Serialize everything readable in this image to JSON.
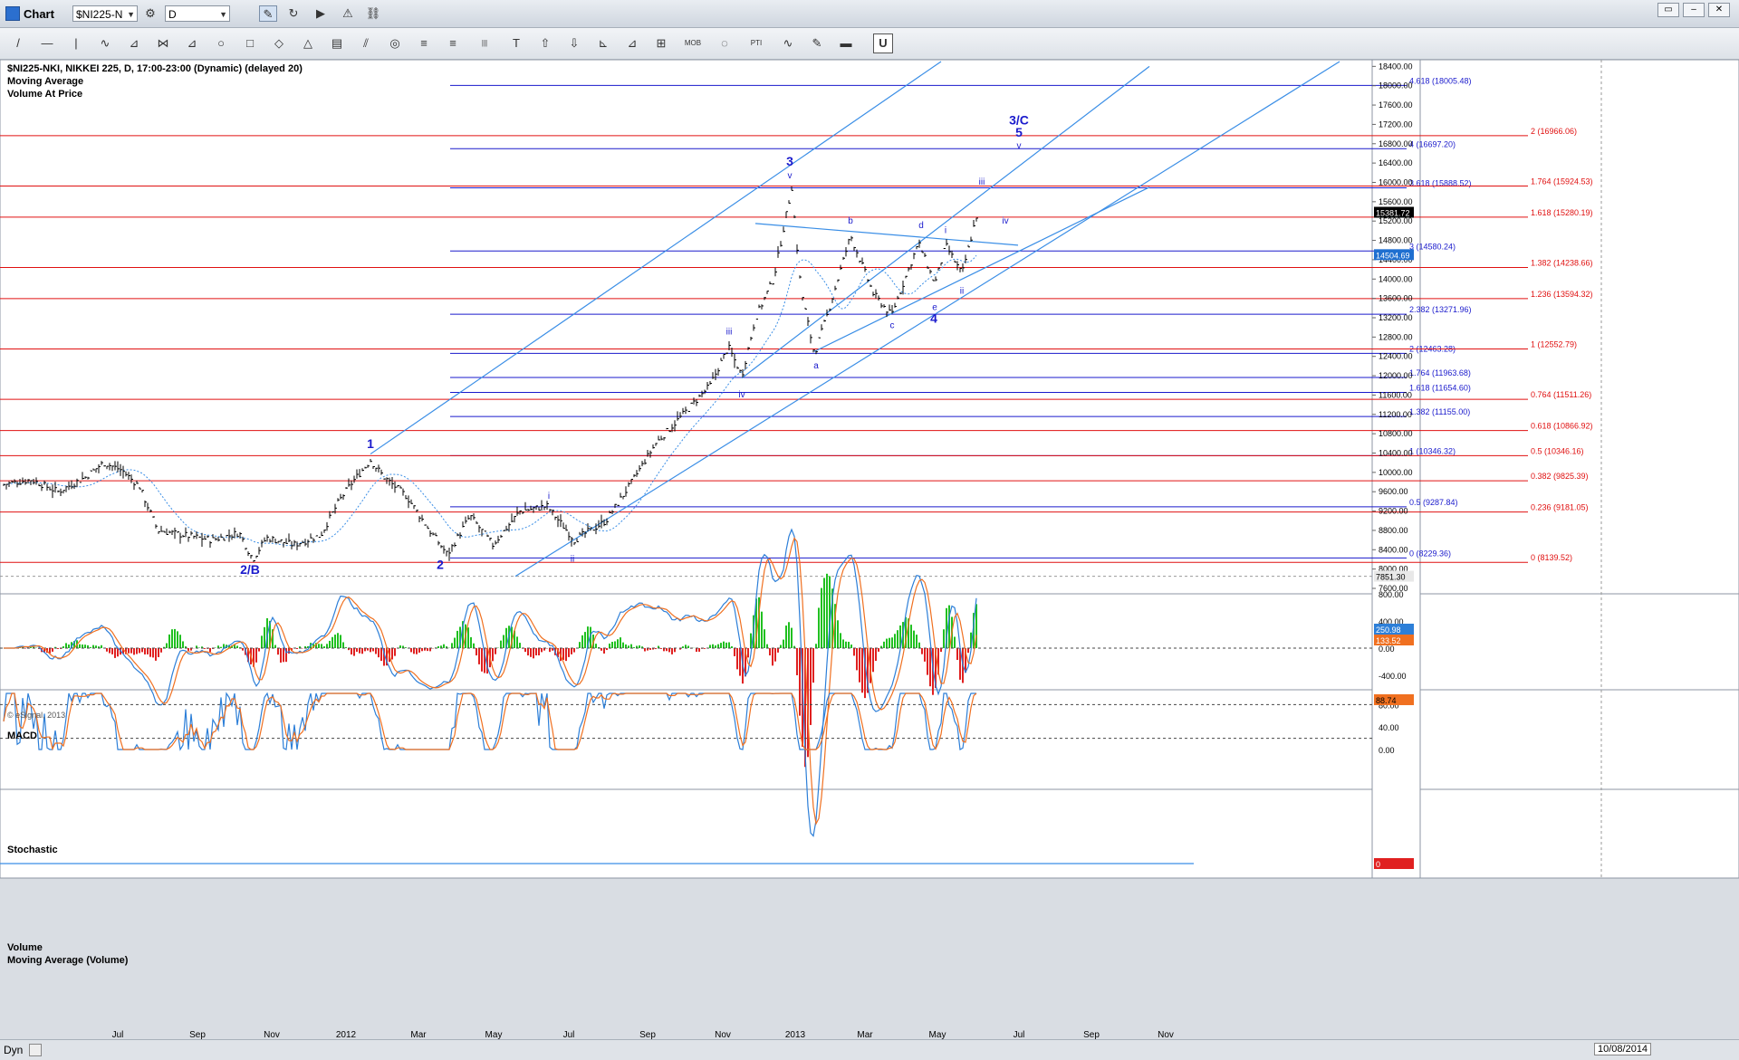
{
  "window": {
    "title": "Chart"
  },
  "toolbar": {
    "symbol": "$NI225-N",
    "interval": "D",
    "tools": [
      "/",
      "—",
      "|",
      "∿",
      "⊿",
      "⋈",
      "⊿",
      "○",
      "□",
      "◇",
      "△",
      "▤",
      "⫽",
      "◎",
      "≡",
      "≡",
      "|||",
      "T",
      "⇧",
      "⇩",
      "⊾",
      "⊿",
      "⊞",
      "MOB",
      "◌",
      "PTI",
      "∿",
      "✎",
      "▬"
    ],
    "lock_icon": "U"
  },
  "header": {
    "line1": "$NI225-NKI, NIKKEI 225, D, 17:00-23:00 (Dynamic) (delayed 20)",
    "line2": "Moving Average",
    "line3": "Volume At Price"
  },
  "copyright": "© eSignal, 2013",
  "panes": {
    "macd": {
      "label": "MACD",
      "macd_value": "250.98",
      "signal_value": "133.52",
      "ticks": [
        "800.00",
        "400.00",
        "0.00",
        "-400.00"
      ]
    },
    "stochastic": {
      "label": "Stochastic",
      "value": "88.74",
      "ticks": [
        "80.00",
        "40.00",
        "0.00"
      ]
    },
    "volume": {
      "label1": "Volume",
      "label2": "Moving Average (Volume)",
      "value": "0"
    }
  },
  "bottom": {
    "label": "Dyn",
    "date_badge": "10/08/2014"
  },
  "colors": {
    "price_bar": "#000000",
    "fib_blue": "#1a1acc",
    "fib_red": "#e01010",
    "channel": "#3a8ee6",
    "ma": "#3a8ee6",
    "wave_label": "#1a1acc",
    "macd_line": "#2d7fd8",
    "signal_line": "#f07020",
    "hist_pos": "#20c020",
    "hist_neg": "#e02020"
  },
  "chart_data": {
    "type": "line",
    "title": "$NI225-NKI, NIKKEI 225, D",
    "x_ticks": [
      "Jul",
      "Sep",
      "Nov",
      "2012",
      "Mar",
      "May",
      "Jul",
      "Sep",
      "Nov",
      "2013",
      "Mar",
      "May",
      "Jul",
      "Sep",
      "Nov"
    ],
    "y_ticks": [
      18400,
      18000,
      17600,
      17200,
      16800,
      16400,
      16000,
      15600,
      15200,
      14800,
      14400,
      14000,
      13600,
      13200,
      12800,
      12400,
      12000,
      11600,
      11200,
      10800,
      10400,
      10000,
      9600,
      9200,
      8800,
      8400,
      8000,
      7600
    ],
    "ylim": [
      7600,
      18500
    ],
    "last_price": "15381.72",
    "ma_value": "14504.69",
    "crosshair_value": "7851.30",
    "price_anchors": [
      {
        "t": 0,
        "v": 9750
      },
      {
        "t": 30,
        "v": 9850
      },
      {
        "t": 60,
        "v": 9600
      },
      {
        "t": 90,
        "v": 9900
      },
      {
        "t": 110,
        "v": 10200
      },
      {
        "t": 130,
        "v": 10050
      },
      {
        "t": 150,
        "v": 9700
      },
      {
        "t": 170,
        "v": 8800
      },
      {
        "t": 200,
        "v": 8700
      },
      {
        "t": 230,
        "v": 8600
      },
      {
        "t": 260,
        "v": 8750
      },
      {
        "t": 275,
        "v": 8200
      },
      {
        "t": 290,
        "v": 8650
      },
      {
        "t": 320,
        "v": 8500
      },
      {
        "t": 350,
        "v": 8700
      },
      {
        "t": 370,
        "v": 9400
      },
      {
        "t": 385,
        "v": 9800
      },
      {
        "t": 405,
        "v": 10250
      },
      {
        "t": 420,
        "v": 9900
      },
      {
        "t": 445,
        "v": 9500
      },
      {
        "t": 470,
        "v": 8800
      },
      {
        "t": 490,
        "v": 8300
      },
      {
        "t": 515,
        "v": 9100
      },
      {
        "t": 540,
        "v": 8500
      },
      {
        "t": 570,
        "v": 9200
      },
      {
        "t": 600,
        "v": 9300
      },
      {
        "t": 630,
        "v": 8600
      },
      {
        "t": 665,
        "v": 9000
      },
      {
        "t": 690,
        "v": 9700
      },
      {
        "t": 720,
        "v": 10600
      },
      {
        "t": 750,
        "v": 11200
      },
      {
        "t": 780,
        "v": 11800
      },
      {
        "t": 800,
        "v": 12600
      },
      {
        "t": 815,
        "v": 12000
      },
      {
        "t": 830,
        "v": 13200
      },
      {
        "t": 850,
        "v": 14000
      },
      {
        "t": 870,
        "v": 15900
      },
      {
        "t": 880,
        "v": 13800
      },
      {
        "t": 895,
        "v": 12450
      },
      {
        "t": 910,
        "v": 13300
      },
      {
        "t": 935,
        "v": 14900
      },
      {
        "t": 960,
        "v": 13700
      },
      {
        "t": 980,
        "v": 13250
      },
      {
        "t": 1010,
        "v": 14750
      },
      {
        "t": 1028,
        "v": 13900
      },
      {
        "t": 1040,
        "v": 14700
      },
      {
        "t": 1058,
        "v": 14100
      },
      {
        "t": 1075,
        "v": 15380
      }
    ],
    "fib_levels_blue": [
      {
        "ratio": "4.618",
        "value": 18005.48
      },
      {
        "ratio": "4",
        "value": 16697.2
      },
      {
        "ratio": "3.618",
        "value": 15888.52
      },
      {
        "ratio": "3",
        "value": 14580.24
      },
      {
        "ratio": "2.382",
        "value": 13271.96
      },
      {
        "ratio": "2",
        "value": 12463.28
      },
      {
        "ratio": "1.764",
        "value": 11963.68
      },
      {
        "ratio": "1.618",
        "value": 11654.6
      },
      {
        "ratio": "1.382",
        "value": 11155.0
      },
      {
        "ratio": "1",
        "value": 10346.32
      },
      {
        "ratio": "0.5",
        "value": 9287.84
      },
      {
        "ratio": "0",
        "value": 8229.36
      }
    ],
    "fib_levels_red": [
      {
        "ratio": "2",
        "value": 16966.06
      },
      {
        "ratio": "1.764",
        "value": 15924.53
      },
      {
        "ratio": "1.618",
        "value": 15280.19
      },
      {
        "ratio": "1.382",
        "value": 14238.66
      },
      {
        "ratio": "1.236",
        "value": 13594.32
      },
      {
        "ratio": "1",
        "value": 12552.79
      },
      {
        "ratio": "0.764",
        "value": 11511.26
      },
      {
        "ratio": "0.618",
        "value": 10866.92
      },
      {
        "ratio": "0.5",
        "value": 10346.16
      },
      {
        "ratio": "0.382",
        "value": 9825.39
      },
      {
        "ratio": "0.236",
        "value": 9181.05
      },
      {
        "ratio": "0",
        "value": 8139.52
      }
    ],
    "wave_labels": [
      {
        "text": "1",
        "t": 405,
        "v": 10500,
        "size": "big"
      },
      {
        "text": "2/B",
        "t": 272,
        "v": 7900,
        "size": "big"
      },
      {
        "text": "2",
        "t": 482,
        "v": 8000,
        "size": "big"
      },
      {
        "text": "3",
        "t": 868,
        "v": 16350,
        "size": "big"
      },
      {
        "text": "3/C",
        "t": 1121,
        "v": 17200,
        "size": "big"
      },
      {
        "text": "5",
        "t": 1121,
        "v": 16950,
        "size": "big"
      },
      {
        "text": "4",
        "t": 1027,
        "v": 13100,
        "size": "big"
      },
      {
        "text": "v",
        "t": 868,
        "v": 16080,
        "size": "small"
      },
      {
        "text": "v",
        "t": 1121,
        "v": 16700,
        "size": "small"
      },
      {
        "text": "iii",
        "t": 1080,
        "v": 15950,
        "size": "small"
      },
      {
        "text": "iv",
        "t": 1106,
        "v": 15150,
        "size": "small"
      },
      {
        "text": "b",
        "t": 935,
        "v": 15150,
        "size": "small"
      },
      {
        "text": "d",
        "t": 1013,
        "v": 15050,
        "size": "small"
      },
      {
        "text": "i",
        "t": 1040,
        "v": 14950,
        "size": "small"
      },
      {
        "text": "c",
        "t": 981,
        "v": 12980,
        "size": "small"
      },
      {
        "text": "e",
        "t": 1028,
        "v": 13360,
        "size": "small"
      },
      {
        "text": "ii",
        "t": 1058,
        "v": 13700,
        "size": "small"
      },
      {
        "text": "a",
        "t": 897,
        "v": 12150,
        "size": "small"
      },
      {
        "text": "iii",
        "t": 801,
        "v": 12850,
        "size": "small"
      },
      {
        "text": "iv",
        "t": 815,
        "v": 11550,
        "size": "small"
      },
      {
        "text": "i",
        "t": 602,
        "v": 9450,
        "size": "small"
      },
      {
        "text": "ii",
        "t": 628,
        "v": 8150,
        "size": "small"
      }
    ],
    "trendlines": [
      {
        "t1": 405,
        "v1": 10380,
        "t2": 1035,
        "v2": 18500
      },
      {
        "t1": 565,
        "v1": 7850,
        "t2": 1475,
        "v2": 18500
      },
      {
        "t1": 815,
        "v1": 11950,
        "t2": 1265,
        "v2": 18400
      },
      {
        "t1": 895,
        "v1": 12500,
        "t2": 1265,
        "v2": 15900
      },
      {
        "t1": 830,
        "v1": 15150,
        "t2": 1120,
        "v2": 14700
      }
    ]
  }
}
